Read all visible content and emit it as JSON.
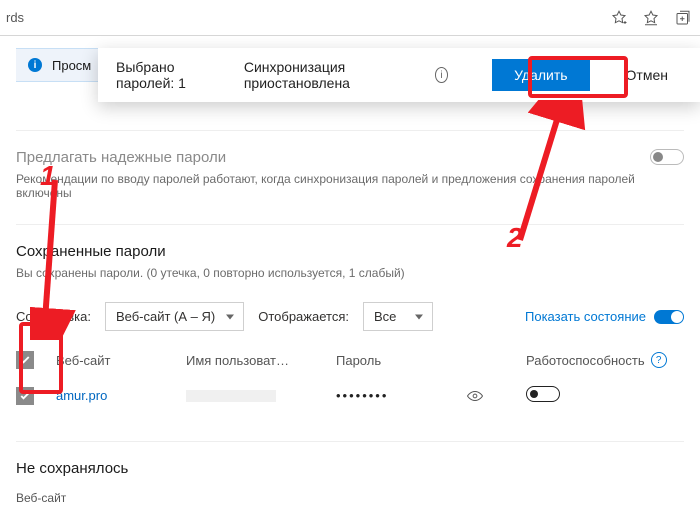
{
  "addressbar": {
    "url_fragment": "rds"
  },
  "notice": {
    "text": "Просм"
  },
  "selection_toolbar": {
    "count_label": "Выбрано паролей: 1",
    "sync_status": "Синхронизация приостановлена",
    "delete_label": "Удалить",
    "cancel_label": "Отмен"
  },
  "suggest_section": {
    "title": "Предлагать надежные пароли",
    "subtitle": "Рекомендации по вводу паролей работают, когда синхронизация паролей и предложения сохранения паролей включены"
  },
  "saved_section": {
    "title": "Сохраненные пароли",
    "subtitle": "Вы сохранены пароли. (0 утечка, 0 повторно используется, 1 слабый)"
  },
  "filters": {
    "sort_label": "Сортировка:",
    "sort_value": "Веб-сайт (А – Я)",
    "display_label": "Отображается:",
    "display_value": "Все",
    "health_label": "Показать состояние"
  },
  "table": {
    "headers": {
      "site": "Веб-сайт",
      "user": "Имя пользоват…",
      "password": "Пароль",
      "health": "Работоспособность"
    },
    "rows": [
      {
        "site": "amur.pro",
        "password_mask": "••••••••"
      }
    ]
  },
  "never_section": {
    "title": "Не сохранялось",
    "site_col": "Веб-сайт"
  },
  "annotations": {
    "step1": "1",
    "step2": "2"
  }
}
